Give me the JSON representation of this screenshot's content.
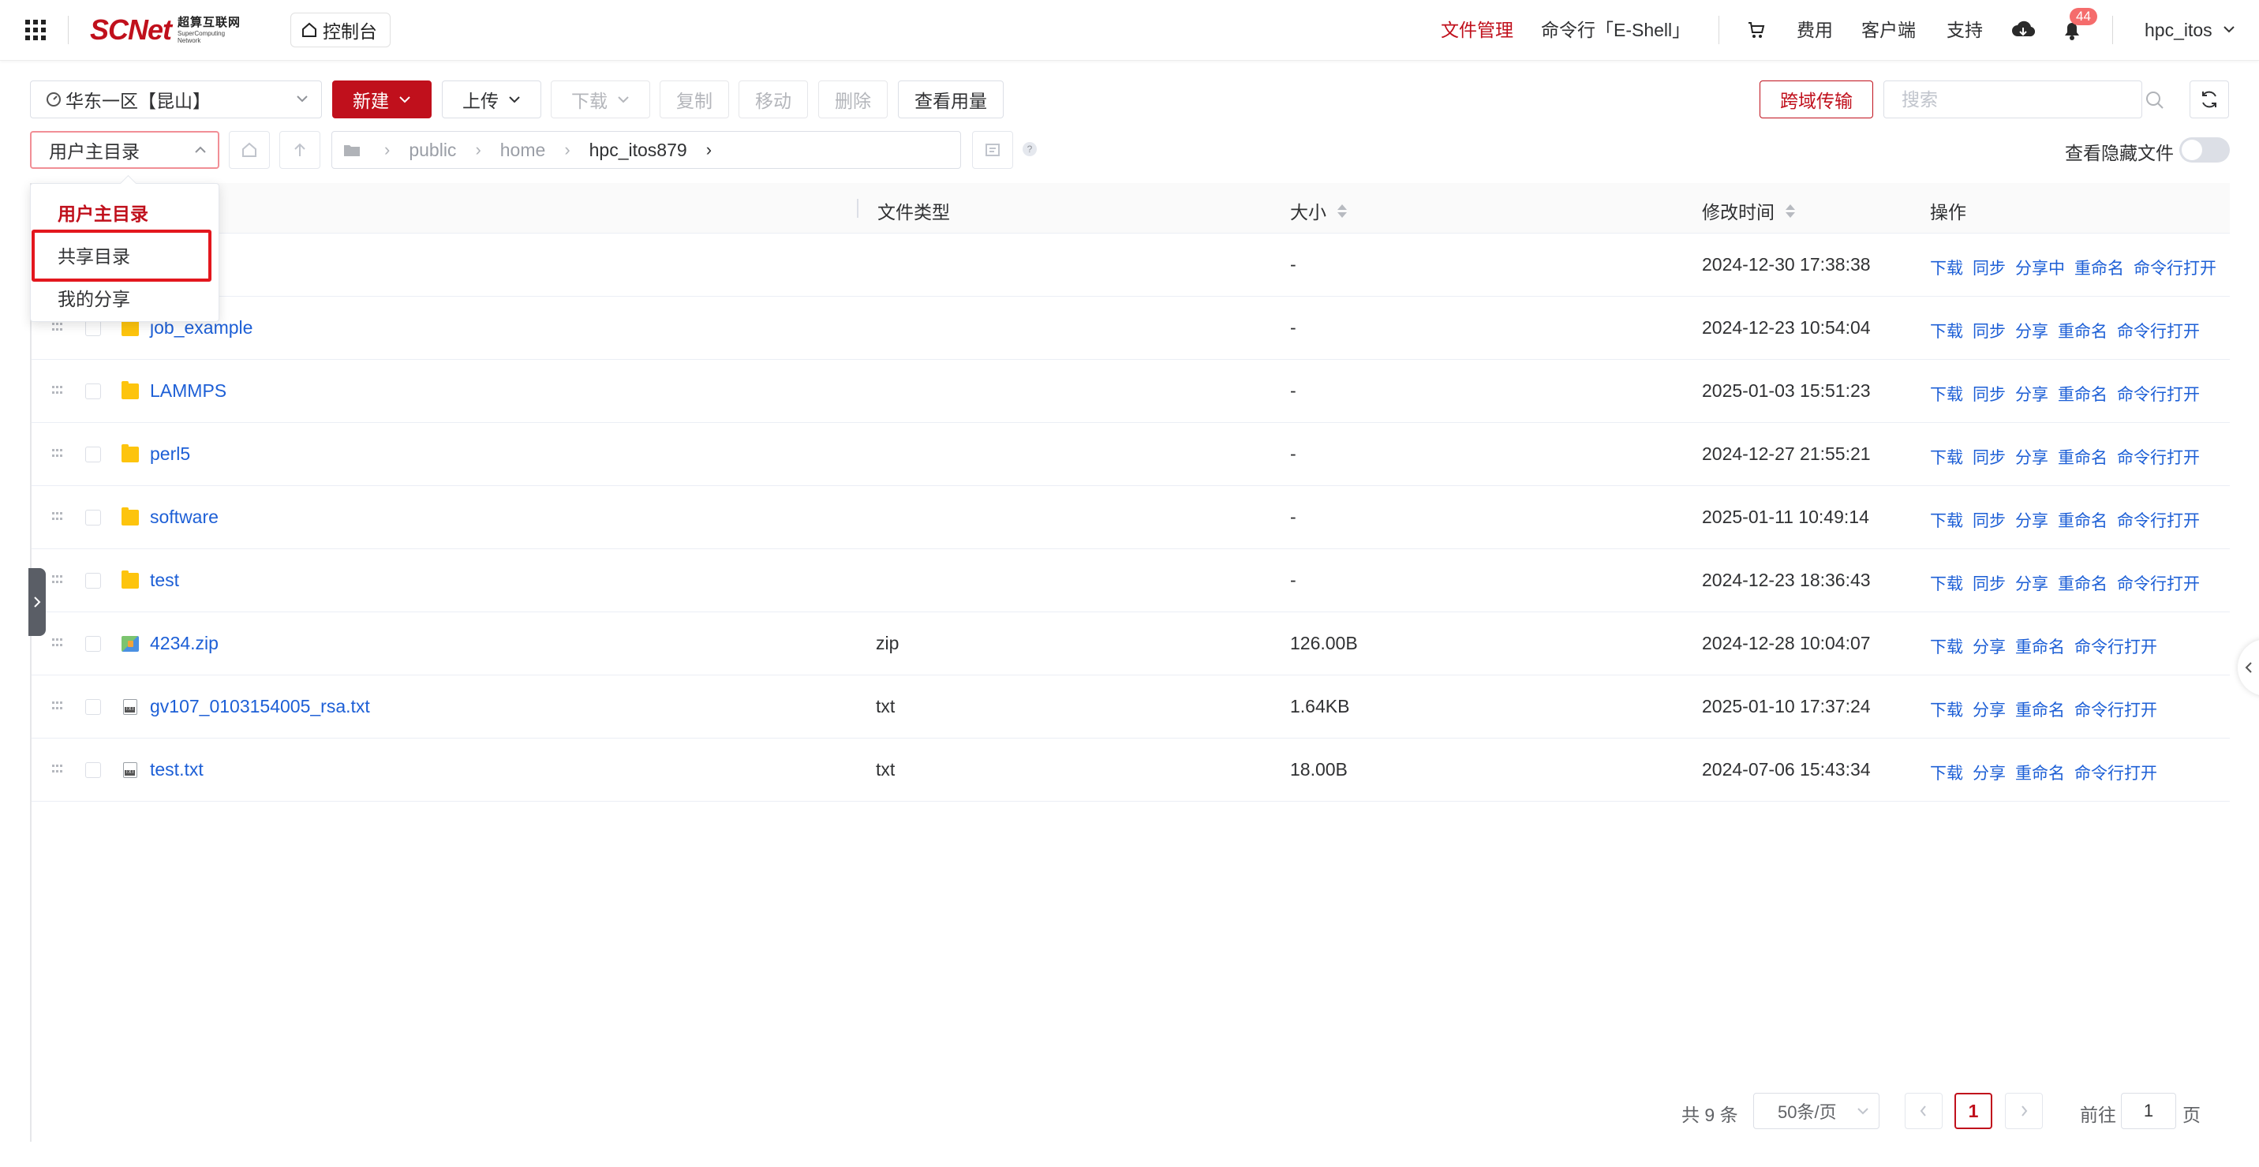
{
  "header": {
    "logo_main": "SCNet",
    "logo_cn": "超算互联网",
    "logo_en_1": "SuperComputing",
    "logo_en_2": "Network",
    "console": "控制台",
    "nav": {
      "file_mgmt": "文件管理",
      "shell": "命令行「E-Shell」",
      "fees": "费用",
      "client": "客户端",
      "support": "支持",
      "user": "hpc_itos"
    },
    "notification_count": "44",
    "active_color": "#c0101c"
  },
  "toolbar": {
    "region": "华东一区【昆山】",
    "new": "新建",
    "upload": "上传",
    "download": "下载",
    "copy": "复制",
    "move": "移动",
    "delete": "删除",
    "usage": "查看用量",
    "cross_domain": "跨域传输",
    "search_placeholder": "搜索"
  },
  "pathbar": {
    "directory": "用户主目录",
    "breadcrumb": [
      "public",
      "home",
      "hpc_itos879"
    ],
    "help": "?",
    "show_hidden": "查看隐藏文件"
  },
  "dropdown": {
    "items": [
      "用户主目录",
      "共享目录",
      "我的分享"
    ],
    "selected": "用户主目录",
    "highlighted": "共享目录"
  },
  "table": {
    "headers": {
      "type": "文件类型",
      "size": "大小",
      "modified": "修改时间",
      "ops": "操作"
    },
    "rows": [
      {
        "name": "",
        "kind": "folder",
        "type": "",
        "size": "-",
        "modified": "2024-12-30 17:38:38",
        "ops": [
          "下载",
          "同步",
          "分享中",
          "重命名",
          "命令行打开"
        ]
      },
      {
        "name": "job_example",
        "kind": "folder",
        "type": "",
        "size": "-",
        "modified": "2024-12-23 10:54:04",
        "ops": [
          "下载",
          "同步",
          "分享",
          "重命名",
          "命令行打开"
        ]
      },
      {
        "name": "LAMMPS",
        "kind": "folder",
        "type": "",
        "size": "-",
        "modified": "2025-01-03 15:51:23",
        "ops": [
          "下载",
          "同步",
          "分享",
          "重命名",
          "命令行打开"
        ]
      },
      {
        "name": "perl5",
        "kind": "folder",
        "type": "",
        "size": "-",
        "modified": "2024-12-27 21:55:21",
        "ops": [
          "下载",
          "同步",
          "分享",
          "重命名",
          "命令行打开"
        ]
      },
      {
        "name": "software",
        "kind": "folder",
        "type": "",
        "size": "-",
        "modified": "2025-01-11 10:49:14",
        "ops": [
          "下载",
          "同步",
          "分享",
          "重命名",
          "命令行打开"
        ]
      },
      {
        "name": "test",
        "kind": "folder",
        "type": "",
        "size": "-",
        "modified": "2024-12-23 18:36:43",
        "ops": [
          "下载",
          "同步",
          "分享",
          "重命名",
          "命令行打开"
        ]
      },
      {
        "name": "4234.zip",
        "kind": "zip",
        "type": "zip",
        "size": "126.00B",
        "modified": "2024-12-28 10:04:07",
        "ops": [
          "下载",
          "分享",
          "重命名",
          "命令行打开"
        ]
      },
      {
        "name": "gv107_0103154005_rsa.txt",
        "kind": "txt",
        "type": "txt",
        "size": "1.64KB",
        "modified": "2025-01-10 17:37:24",
        "ops": [
          "下载",
          "分享",
          "重命名",
          "命令行打开"
        ]
      },
      {
        "name": "test.txt",
        "kind": "txt",
        "type": "txt",
        "size": "18.00B",
        "modified": "2024-07-06 15:43:34",
        "ops": [
          "下载",
          "分享",
          "重命名",
          "命令行打开"
        ]
      }
    ]
  },
  "pagination": {
    "total": "共 9 条",
    "page_size": "50条/页",
    "current": "1",
    "goto_prefix": "前往",
    "goto_value": "1",
    "goto_suffix": "页"
  }
}
